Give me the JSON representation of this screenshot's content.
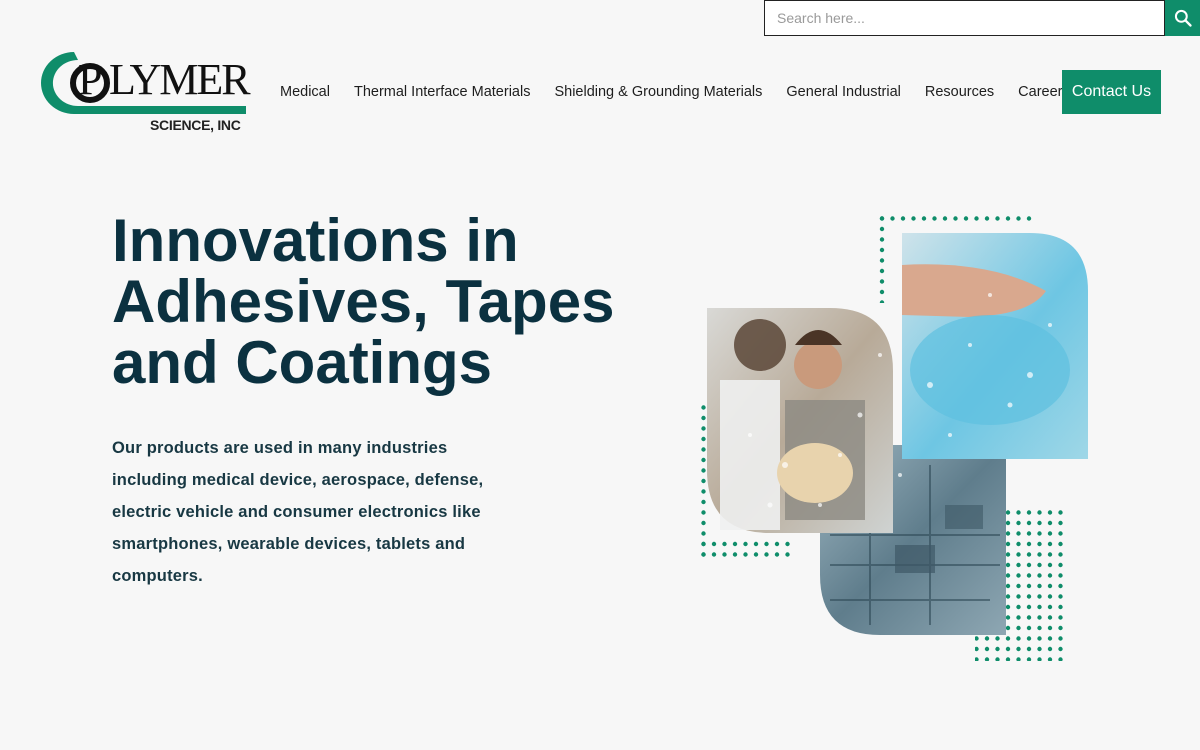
{
  "search": {
    "placeholder": "Search here..."
  },
  "logo": {
    "word_lead": "P",
    "word_rest": "LYMER",
    "sub": "SCIENCE, INC"
  },
  "nav": {
    "items": [
      {
        "label": "Medical"
      },
      {
        "label": "Thermal Interface Materials"
      },
      {
        "label": "Shielding & Grounding Materials"
      },
      {
        "label": "General Industrial"
      },
      {
        "label": "Resources"
      },
      {
        "label": "Careers"
      }
    ],
    "contact_label": "Contact Us"
  },
  "hero": {
    "title": "Innovations in Adhesives, Tapes and Coatings",
    "description": "Our products are used in many industries including medical device, aerospace, defense, electric vehicle and consumer electronics like smartphones, wearable devices, tablets and computers."
  },
  "colors": {
    "accent": "#0f8d6a",
    "heading": "#0b3140",
    "background": "#f7f7f7"
  },
  "icons": {
    "search": "search-icon"
  }
}
